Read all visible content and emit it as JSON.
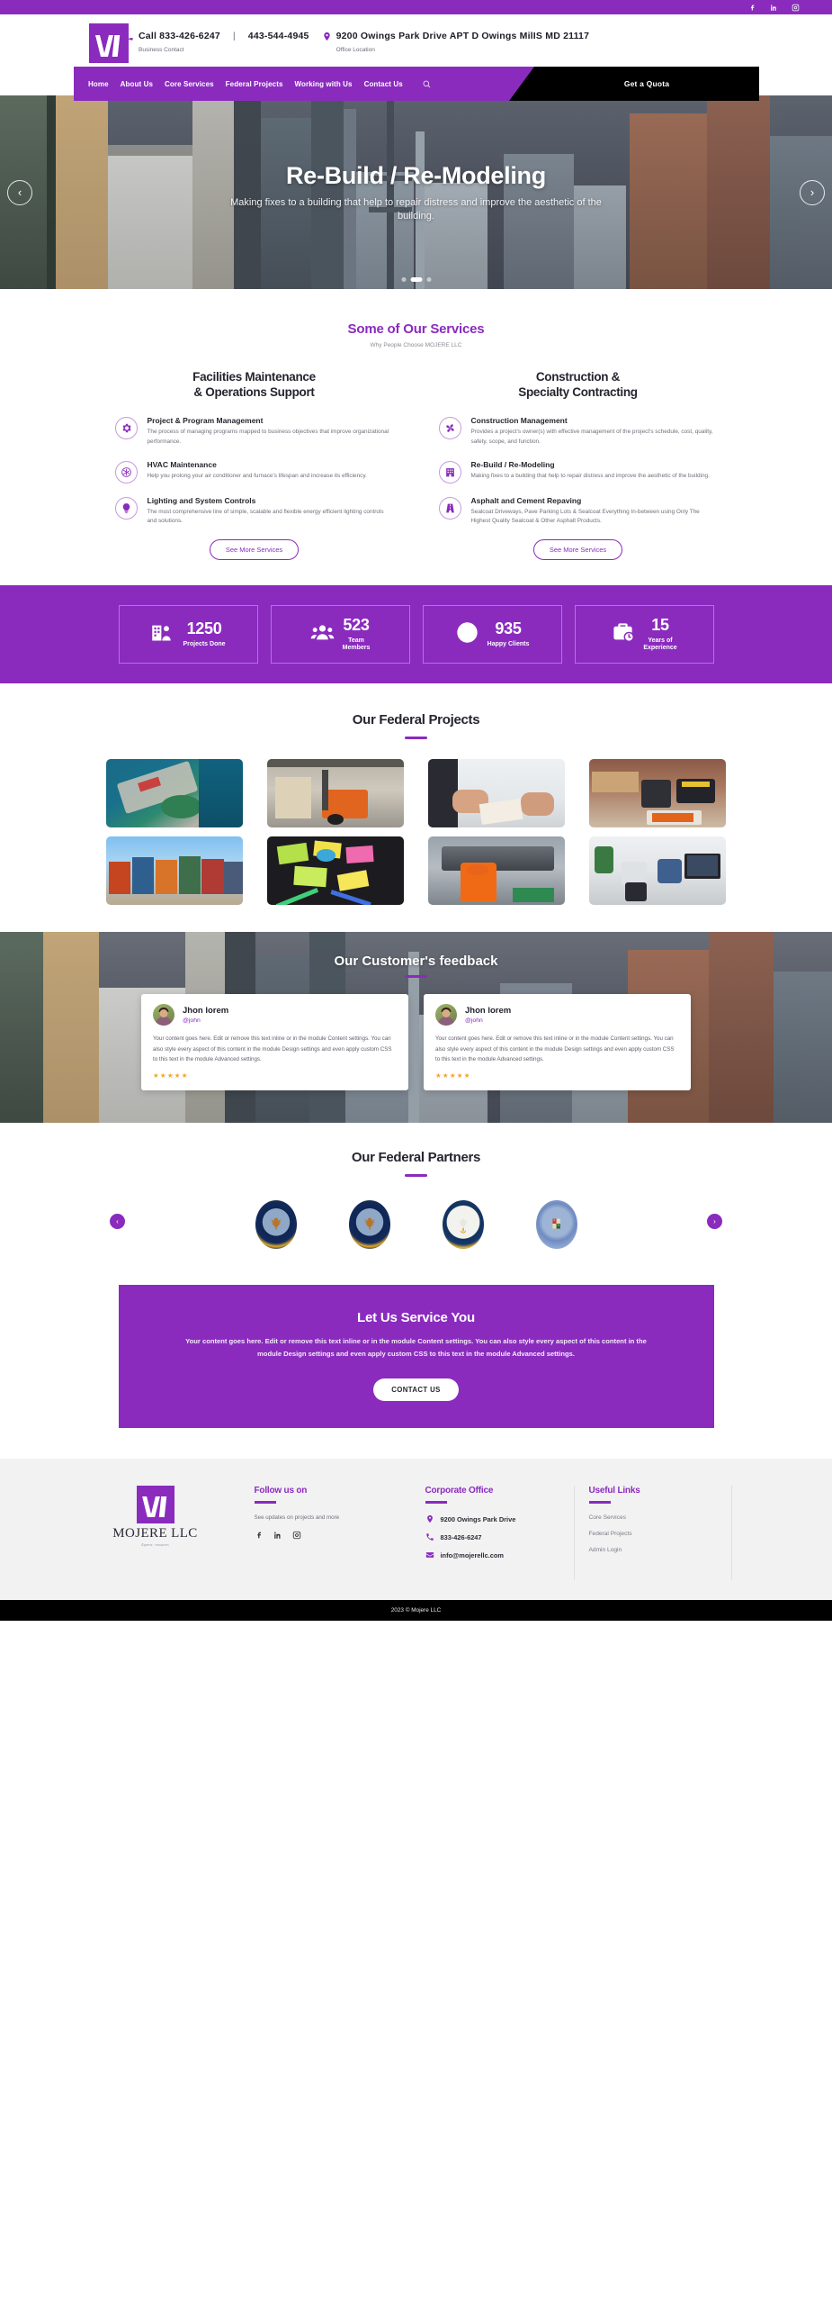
{
  "topbar": {
    "socials": [
      "facebook-icon",
      "linkedin-icon",
      "instagram-icon"
    ]
  },
  "brand": {
    "name": "MOJERE LLC",
    "tagline": "Experts · resources"
  },
  "header": {
    "phone_primary": "Call 833-426-6247",
    "separator": "|",
    "phone_secondary": "443-544-4945",
    "contact_caption": "Business Contact",
    "address": "9200 Owings Park Drive APT D Owings MilIS MD 21117",
    "address_caption": "Office Location"
  },
  "nav": {
    "items": [
      "Home",
      "About Us",
      "Core Services",
      "Federal Projects",
      "Working with Us",
      "Contact Us"
    ],
    "search_icon": "search-icon",
    "cta_label": "Get a Quota"
  },
  "hero": {
    "title": "Re-Build / Re-Modeling",
    "subtitle": "Making fixes to a building that help to repair distress and improve the aesthetic of the building.",
    "prev_label": "‹",
    "next_label": "›",
    "slide_count": 3,
    "active_slide": 2
  },
  "services": {
    "title": "Some of Our Services",
    "subtitle": "Why People Choose MOJERE LLC",
    "button_label": "See More Services",
    "columns": [
      {
        "heading_line1": "Facilities Maintenance",
        "heading_line2": "& Operations Support",
        "items": [
          {
            "icon": "gear-icon",
            "name": "Project & Program Management",
            "desc": "The process of managing programs mapped to business objectives that improve organizational performance."
          },
          {
            "icon": "snowflake-icon",
            "name": "HVAC Maintenance",
            "desc": "Help you prolong your air conditioner and furnace's lifespan and increase its efficiency."
          },
          {
            "icon": "lightbulb-icon",
            "name": "Lighting and System Controls",
            "desc": "The most comprehensive line of simple, scalable and flexible energy efficient lighting controls and solutions."
          }
        ]
      },
      {
        "heading_line1": "Construction &",
        "heading_line2": "Specialty Contracting",
        "items": [
          {
            "icon": "pinwheel-icon",
            "name": "Construction Management",
            "desc": "Provides a project's owner(s) with effective management of the project's schedule, cost, quality, safety, scope, and function."
          },
          {
            "icon": "building-icon",
            "name": "Re-Build / Re-Modeling",
            "desc": "Making fixes to a building that help to repair distress and improve the aesthetic of the building."
          },
          {
            "icon": "road-icon",
            "name": "Asphalt and Cement Repaving",
            "desc": "Sealcoat Driveways, Pave Parking Lots & Sealcoat Everything In-between using Only The Highest Quality Sealcoat & Other Asphalt Products."
          }
        ]
      }
    ]
  },
  "stats": [
    {
      "icon": "building-people-icon",
      "number": "1250",
      "label": "Projects Done"
    },
    {
      "icon": "people-icon",
      "number": "523",
      "label": "Team\nMembers"
    },
    {
      "icon": "globe-icon",
      "number": "935",
      "label": "Happy Clients"
    },
    {
      "icon": "briefcase-clock-icon",
      "number": "15",
      "label": "Years of\nExperience"
    }
  ],
  "projects": {
    "title": "Our Federal Projects",
    "tiles": [
      "aerial-view-of-coastal-development",
      "forklift-moving-pallets-in-warehouse",
      "hands-signing-documents-at-desk",
      "power-drill-and-toolbox-on-workbench",
      "stacked-shipping-containers",
      "colorful-sticky-notes-and-markers",
      "worker-in-orange-vest-at-machinery",
      "office-workers-at-computer-desks"
    ]
  },
  "testimonials": {
    "title": "Our Customer's feedback",
    "cards": [
      {
        "avatar": "user-avatar",
        "name": "Jhon lorem",
        "handle": "@john",
        "text": "Your content goes here. Edit or remove this text inline or in the module Content settings. You can also style every aspect of this content in the module Design settings and even apply custom CSS to this text in the module Advanced settings.",
        "rating": "★★★★★"
      },
      {
        "avatar": "user-avatar",
        "name": "Jhon lorem",
        "handle": "@john",
        "text": "Your content goes here. Edit or remove this text inline or in the module Content settings. You can also style every aspect of this content in the module Design settings and even apply custom CSS to this text in the module Advanced settings.",
        "rating": "★★★★★"
      }
    ]
  },
  "partners": {
    "title": "Our Federal Partners",
    "prev_label": "‹",
    "next_label": "›",
    "seals": [
      "department-of-veterans-affairs-seal",
      "department-of-veterans-affairs-seal",
      "united-states-navy-seal",
      "state-of-maryland-seal"
    ]
  },
  "cta": {
    "title": "Let Us Service You",
    "body": "Your content goes here. Edit or remove this text inline or in the module Content settings. You can also style every aspect of this content in the module Design settings and even apply custom CSS to this text in the module Advanced settings.",
    "button_label": "CONTACT US"
  },
  "footer": {
    "follow": {
      "title": "Follow us on",
      "note": "See updates on projects and more",
      "socials": [
        "facebook-icon",
        "linkedin-icon",
        "instagram-icon"
      ]
    },
    "office": {
      "title": "Corporate Office",
      "address": "9200 Owings Park Drive",
      "phone": "833-426-6247",
      "email": "info@mojerellc.com"
    },
    "links": {
      "title": "Useful Links",
      "items": [
        "Core Services",
        "Federal Projects",
        "Admin Login"
      ]
    },
    "copyright": "2023 © Mojere LLC"
  },
  "colors": {
    "brand_purple": "#8A2BBE",
    "black": "#000000",
    "star_gold": "#f5a623",
    "footer_bg": "#f2f2f2"
  }
}
